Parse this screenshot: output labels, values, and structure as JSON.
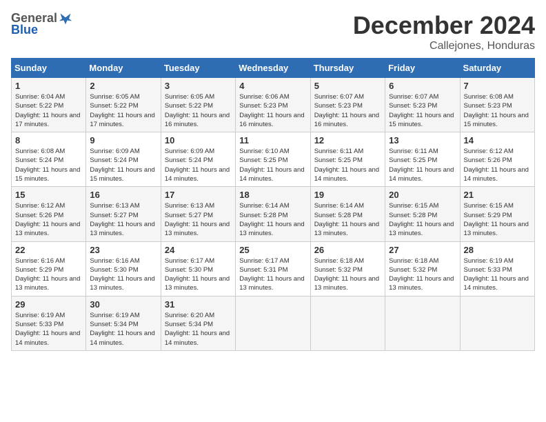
{
  "header": {
    "logo": {
      "general": "General",
      "blue": "Blue"
    },
    "title": "December 2024",
    "subtitle": "Callejones, Honduras"
  },
  "columns": [
    "Sunday",
    "Monday",
    "Tuesday",
    "Wednesday",
    "Thursday",
    "Friday",
    "Saturday"
  ],
  "weeks": [
    [
      {
        "day": "1",
        "sunrise": "6:04 AM",
        "sunset": "5:22 PM",
        "daylight": "11 hours and 17 minutes."
      },
      {
        "day": "2",
        "sunrise": "6:05 AM",
        "sunset": "5:22 PM",
        "daylight": "11 hours and 17 minutes."
      },
      {
        "day": "3",
        "sunrise": "6:05 AM",
        "sunset": "5:22 PM",
        "daylight": "11 hours and 16 minutes."
      },
      {
        "day": "4",
        "sunrise": "6:06 AM",
        "sunset": "5:23 PM",
        "daylight": "11 hours and 16 minutes."
      },
      {
        "day": "5",
        "sunrise": "6:07 AM",
        "sunset": "5:23 PM",
        "daylight": "11 hours and 16 minutes."
      },
      {
        "day": "6",
        "sunrise": "6:07 AM",
        "sunset": "5:23 PM",
        "daylight": "11 hours and 15 minutes."
      },
      {
        "day": "7",
        "sunrise": "6:08 AM",
        "sunset": "5:23 PM",
        "daylight": "11 hours and 15 minutes."
      }
    ],
    [
      {
        "day": "8",
        "sunrise": "6:08 AM",
        "sunset": "5:24 PM",
        "daylight": "11 hours and 15 minutes."
      },
      {
        "day": "9",
        "sunrise": "6:09 AM",
        "sunset": "5:24 PM",
        "daylight": "11 hours and 15 minutes."
      },
      {
        "day": "10",
        "sunrise": "6:09 AM",
        "sunset": "5:24 PM",
        "daylight": "11 hours and 14 minutes."
      },
      {
        "day": "11",
        "sunrise": "6:10 AM",
        "sunset": "5:25 PM",
        "daylight": "11 hours and 14 minutes."
      },
      {
        "day": "12",
        "sunrise": "6:11 AM",
        "sunset": "5:25 PM",
        "daylight": "11 hours and 14 minutes."
      },
      {
        "day": "13",
        "sunrise": "6:11 AM",
        "sunset": "5:25 PM",
        "daylight": "11 hours and 14 minutes."
      },
      {
        "day": "14",
        "sunrise": "6:12 AM",
        "sunset": "5:26 PM",
        "daylight": "11 hours and 14 minutes."
      }
    ],
    [
      {
        "day": "15",
        "sunrise": "6:12 AM",
        "sunset": "5:26 PM",
        "daylight": "11 hours and 13 minutes."
      },
      {
        "day": "16",
        "sunrise": "6:13 AM",
        "sunset": "5:27 PM",
        "daylight": "11 hours and 13 minutes."
      },
      {
        "day": "17",
        "sunrise": "6:13 AM",
        "sunset": "5:27 PM",
        "daylight": "11 hours and 13 minutes."
      },
      {
        "day": "18",
        "sunrise": "6:14 AM",
        "sunset": "5:28 PM",
        "daylight": "11 hours and 13 minutes."
      },
      {
        "day": "19",
        "sunrise": "6:14 AM",
        "sunset": "5:28 PM",
        "daylight": "11 hours and 13 minutes."
      },
      {
        "day": "20",
        "sunrise": "6:15 AM",
        "sunset": "5:28 PM",
        "daylight": "11 hours and 13 minutes."
      },
      {
        "day": "21",
        "sunrise": "6:15 AM",
        "sunset": "5:29 PM",
        "daylight": "11 hours and 13 minutes."
      }
    ],
    [
      {
        "day": "22",
        "sunrise": "6:16 AM",
        "sunset": "5:29 PM",
        "daylight": "11 hours and 13 minutes."
      },
      {
        "day": "23",
        "sunrise": "6:16 AM",
        "sunset": "5:30 PM",
        "daylight": "11 hours and 13 minutes."
      },
      {
        "day": "24",
        "sunrise": "6:17 AM",
        "sunset": "5:30 PM",
        "daylight": "11 hours and 13 minutes."
      },
      {
        "day": "25",
        "sunrise": "6:17 AM",
        "sunset": "5:31 PM",
        "daylight": "11 hours and 13 minutes."
      },
      {
        "day": "26",
        "sunrise": "6:18 AM",
        "sunset": "5:32 PM",
        "daylight": "11 hours and 13 minutes."
      },
      {
        "day": "27",
        "sunrise": "6:18 AM",
        "sunset": "5:32 PM",
        "daylight": "11 hours and 13 minutes."
      },
      {
        "day": "28",
        "sunrise": "6:19 AM",
        "sunset": "5:33 PM",
        "daylight": "11 hours and 14 minutes."
      }
    ],
    [
      {
        "day": "29",
        "sunrise": "6:19 AM",
        "sunset": "5:33 PM",
        "daylight": "11 hours and 14 minutes."
      },
      {
        "day": "30",
        "sunrise": "6:19 AM",
        "sunset": "5:34 PM",
        "daylight": "11 hours and 14 minutes."
      },
      {
        "day": "31",
        "sunrise": "6:20 AM",
        "sunset": "5:34 PM",
        "daylight": "11 hours and 14 minutes."
      },
      null,
      null,
      null,
      null
    ]
  ],
  "labels": {
    "sunrise": "Sunrise: ",
    "sunset": "Sunset: ",
    "daylight": "Daylight: "
  }
}
